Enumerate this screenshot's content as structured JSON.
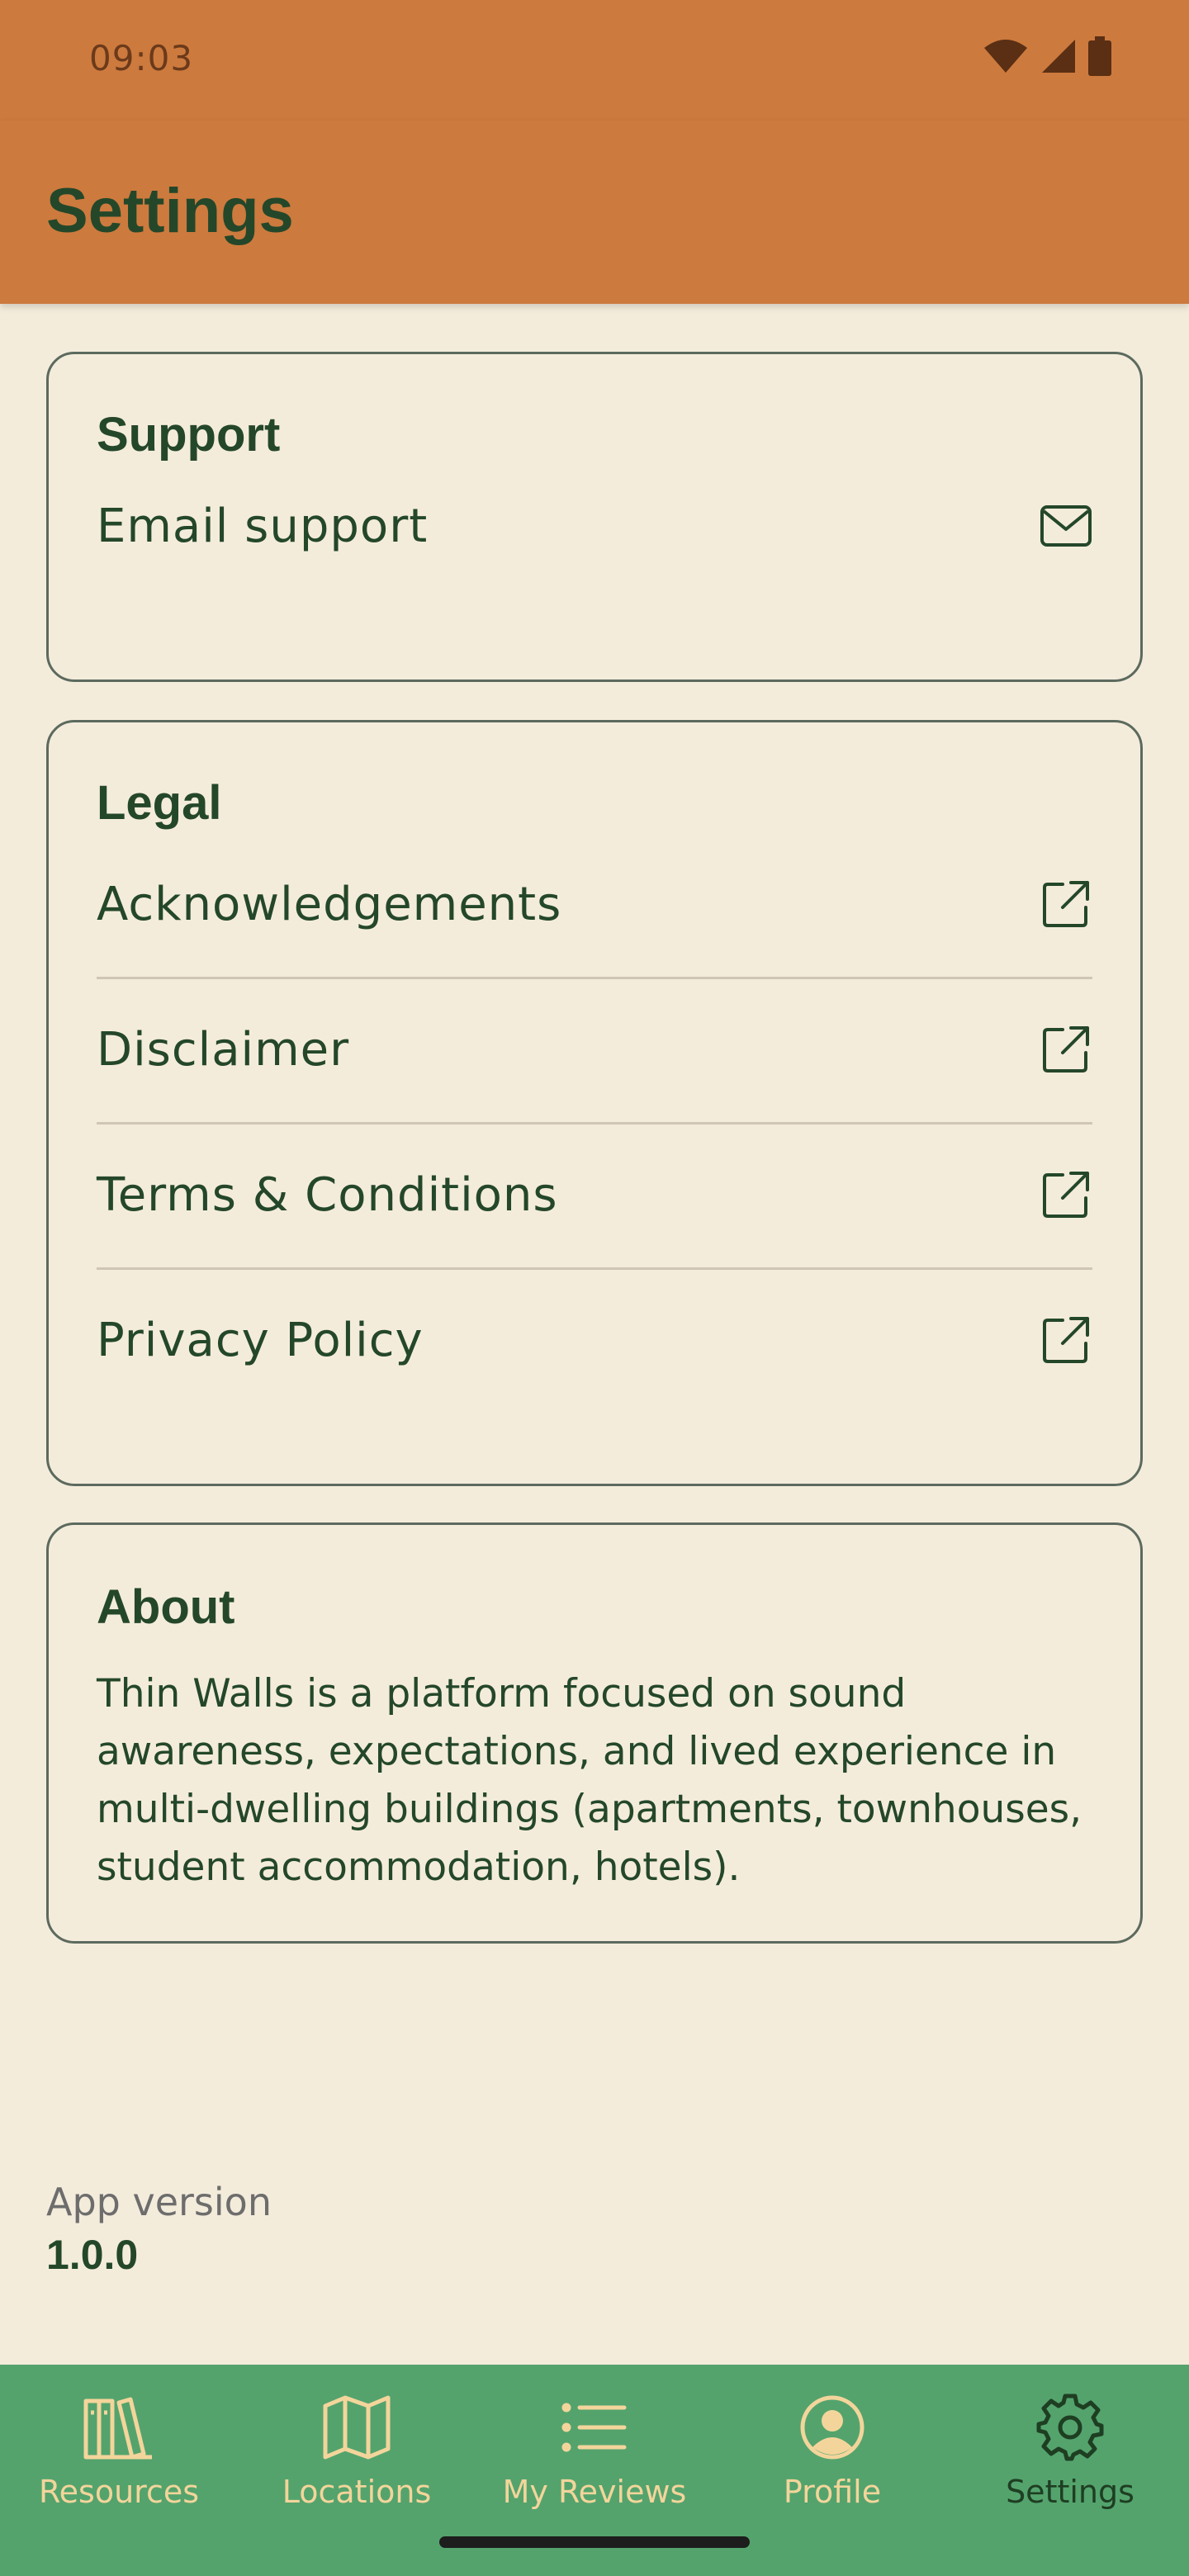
{
  "status_bar": {
    "time": "09:03"
  },
  "app_bar": {
    "title": "Settings"
  },
  "support": {
    "title": "Support",
    "items": [
      {
        "label": "Email support",
        "icon": "mail-icon"
      }
    ]
  },
  "legal": {
    "title": "Legal",
    "items": [
      {
        "label": "Acknowledgements",
        "icon": "external-link-icon"
      },
      {
        "label": "Disclaimer",
        "icon": "external-link-icon"
      },
      {
        "label": "Terms & Conditions",
        "icon": "external-link-icon"
      },
      {
        "label": "Privacy Policy",
        "icon": "external-link-icon"
      }
    ]
  },
  "about": {
    "title": "About",
    "text": "Thin Walls is a platform focused on sound awareness, expectations, and lived experience in multi-dwelling buildings (apartments, townhouses, student accommodation, hotels)."
  },
  "app_version": {
    "label": "App version",
    "value": "1.0.0"
  },
  "bottom_nav": {
    "items": [
      {
        "label": "Resources",
        "icon": "books-icon",
        "active": false
      },
      {
        "label": "Locations",
        "icon": "map-icon",
        "active": false
      },
      {
        "label": "My Reviews",
        "icon": "list-icon",
        "active": false
      },
      {
        "label": "Profile",
        "icon": "profile-icon",
        "active": false
      },
      {
        "label": "Settings",
        "icon": "gear-icon",
        "active": true
      }
    ]
  },
  "colors": {
    "app_bar": "#cd7a3e",
    "background": "#f4ecdb",
    "primary_text": "#24472a",
    "bottom_nav": "#54a36d",
    "nav_inactive": "#f3d59b"
  }
}
